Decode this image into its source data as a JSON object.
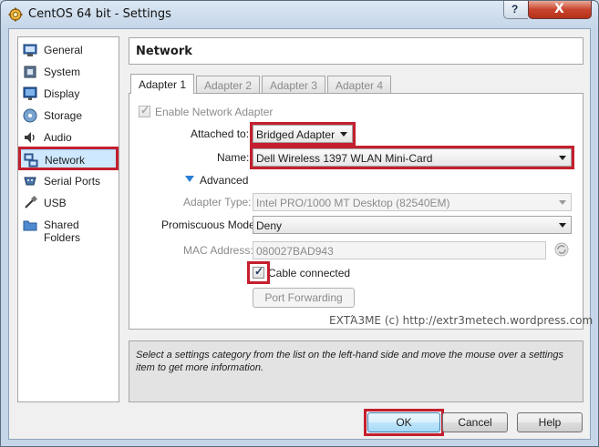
{
  "window": {
    "title": "CentOS 64 bit - Settings",
    "help_label": "?",
    "close_label": "X"
  },
  "sidebar": {
    "items": [
      {
        "label": "General",
        "icon": "general-icon"
      },
      {
        "label": "System",
        "icon": "system-icon"
      },
      {
        "label": "Display",
        "icon": "display-icon"
      },
      {
        "label": "Storage",
        "icon": "storage-icon"
      },
      {
        "label": "Audio",
        "icon": "audio-icon"
      },
      {
        "label": "Network",
        "icon": "network-icon",
        "selected": true
      },
      {
        "label": "Serial Ports",
        "icon": "serial-ports-icon"
      },
      {
        "label": "USB",
        "icon": "usb-icon"
      },
      {
        "label": "Shared Folders",
        "icon": "shared-folders-icon"
      }
    ]
  },
  "page": {
    "title": "Network"
  },
  "tabs": [
    {
      "label": "Adapter 1",
      "mnemonic": "1",
      "active": true
    },
    {
      "label": "Adapter 2",
      "mnemonic": "2",
      "active": false
    },
    {
      "label": "Adapter 3",
      "mnemonic": "3",
      "active": false
    },
    {
      "label": "Adapter 4",
      "mnemonic": "4",
      "active": false
    }
  ],
  "adapter": {
    "enable_label": "Enable Network Adapter",
    "enable_checked": true,
    "attached_to_label": "Attached to:",
    "attached_to_value": "Bridged Adapter",
    "name_label": "Name:",
    "name_value": "Dell Wireless 1397 WLAN Mini-Card",
    "advanced_label": "Advanced",
    "adapter_type_label": "Adapter Type:",
    "adapter_type_value": "Intel PRO/1000 MT Desktop (82540EM)",
    "promiscuous_label": "Promiscuous Mode:",
    "promiscuous_value": "Deny",
    "mac_label": "MAC Address:",
    "mac_value": "080027BAD943",
    "cable_label": "Cable connected",
    "cable_checked": true,
    "port_forwarding_label": "Port Forwarding"
  },
  "watermark": "ΕΧΤΆ3ΜΕ (c) http://extr3metech.wordpress.com",
  "info_text": "Select a settings category from the list on the left-hand side and move the mouse over a settings item to get more information.",
  "buttons": {
    "ok": "OK",
    "cancel": "Cancel",
    "help": "Help"
  },
  "colors": {
    "highlight": "#c41f2e",
    "selection": "#cde8ff"
  }
}
